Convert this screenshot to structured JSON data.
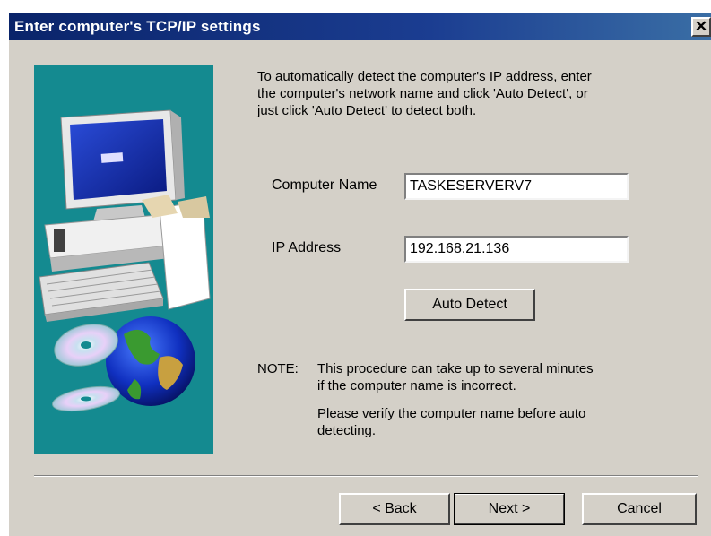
{
  "window": {
    "title": "Enter computer's TCP/IP settings",
    "close_glyph": "✕",
    "close_icon": "close-icon"
  },
  "illustration": {
    "icons": [
      "computer-icon",
      "keyboard-icon",
      "cd-icon",
      "globe-icon"
    ],
    "background_color": "#148a90"
  },
  "intro_lines": [
    "To automatically detect the computer's IP address, enter",
    "the computer's network name and click 'Auto Detect', or",
    "just click 'Auto Detect' to detect both."
  ],
  "form": {
    "computer_name_label": "Computer Name",
    "computer_name_value": "TASKESERVERV7",
    "ip_address_label": "IP Address",
    "ip_address_value": "192.168.21.136",
    "auto_detect_label": "Auto Detect"
  },
  "note": {
    "prefix": "NOTE:",
    "line1": "This procedure can take up to several minutes",
    "line2": "if the computer name is incorrect.",
    "line3": "Please verify the computer name before auto",
    "line4": "detecting."
  },
  "buttons": {
    "back_prefix": "< ",
    "back_hotkey": "B",
    "back_rest": "ack",
    "next_hotkey": "N",
    "next_rest": "ext >",
    "cancel": "Cancel"
  },
  "colors": {
    "titlebar": "#0a246a",
    "dialog_face": "#d4d0c8"
  }
}
